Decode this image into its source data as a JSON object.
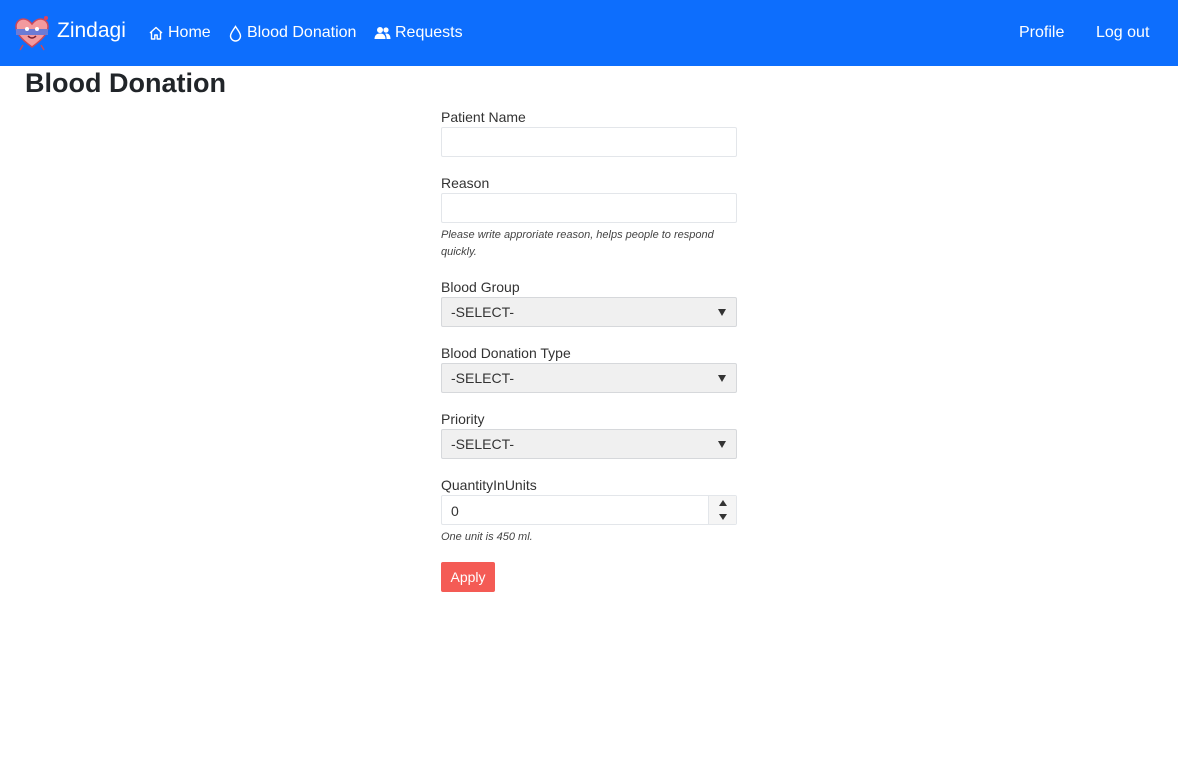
{
  "nav": {
    "brand": "Zindagi",
    "home": "Home",
    "blood_donation": "Blood Donation",
    "requests": "Requests",
    "profile": "Profile",
    "logout": "Log out"
  },
  "page": {
    "title": "Blood Donation"
  },
  "form": {
    "patient_name": {
      "label": "Patient Name",
      "value": ""
    },
    "reason": {
      "label": "Reason",
      "value": "",
      "help": "Please write approriate reason, helps people to respond quickly."
    },
    "blood_group": {
      "label": "Blood Group",
      "selected": "-SELECT-"
    },
    "donation_type": {
      "label": "Blood Donation Type",
      "selected": "-SELECT-"
    },
    "priority": {
      "label": "Priority",
      "selected": "-SELECT-"
    },
    "quantity": {
      "label": "QuantityInUnits",
      "value": "0",
      "help": "One unit is 450 ml."
    },
    "apply_label": "Apply"
  },
  "colors": {
    "navbar": "#0d6efd",
    "apply_button": "#f45b55",
    "select_bg": "#f0f0f0"
  },
  "icons": [
    "heart-mascot-logo",
    "home-icon",
    "blood-drop-icon",
    "users-icon",
    "caret-down-icon",
    "stepper-up-icon",
    "stepper-down-icon"
  ]
}
